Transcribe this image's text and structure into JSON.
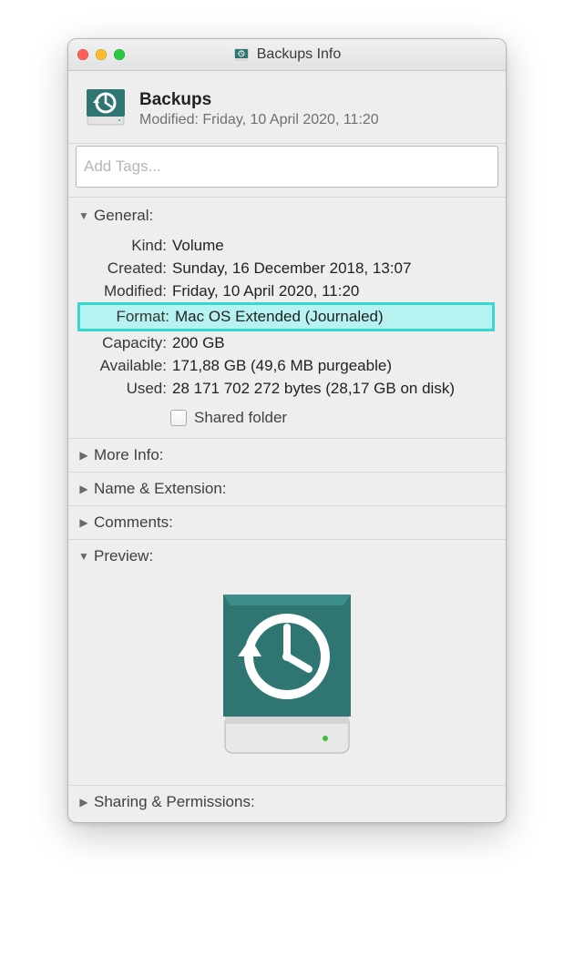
{
  "window": {
    "title": "Backups Info"
  },
  "header": {
    "name": "Backups",
    "modified_label": "Modified:",
    "modified_value": "Friday, 10 April 2020, 11:20"
  },
  "tags": {
    "placeholder": "Add Tags..."
  },
  "sections": {
    "general": {
      "title": "General:",
      "kind_label": "Kind:",
      "kind_value": "Volume",
      "created_label": "Created:",
      "created_value": "Sunday, 16 December 2018, 13:07",
      "modified_label": "Modified:",
      "modified_value": "Friday, 10 April 2020, 11:20",
      "format_label": "Format:",
      "format_value": "Mac OS Extended (Journaled)",
      "capacity_label": "Capacity:",
      "capacity_value": "200 GB",
      "available_label": "Available:",
      "available_value": "171,88 GB (49,6 MB purgeable)",
      "used_label": "Used:",
      "used_value": "28 171 702 272 bytes (28,17 GB on disk)",
      "shared_folder_label": "Shared folder"
    },
    "more_info": {
      "title": "More Info:"
    },
    "name_extension": {
      "title": "Name & Extension:"
    },
    "comments": {
      "title": "Comments:"
    },
    "preview": {
      "title": "Preview:"
    },
    "sharing_permissions": {
      "title": "Sharing & Permissions:"
    }
  },
  "icons": {
    "time_machine_color": "#2f7672"
  }
}
